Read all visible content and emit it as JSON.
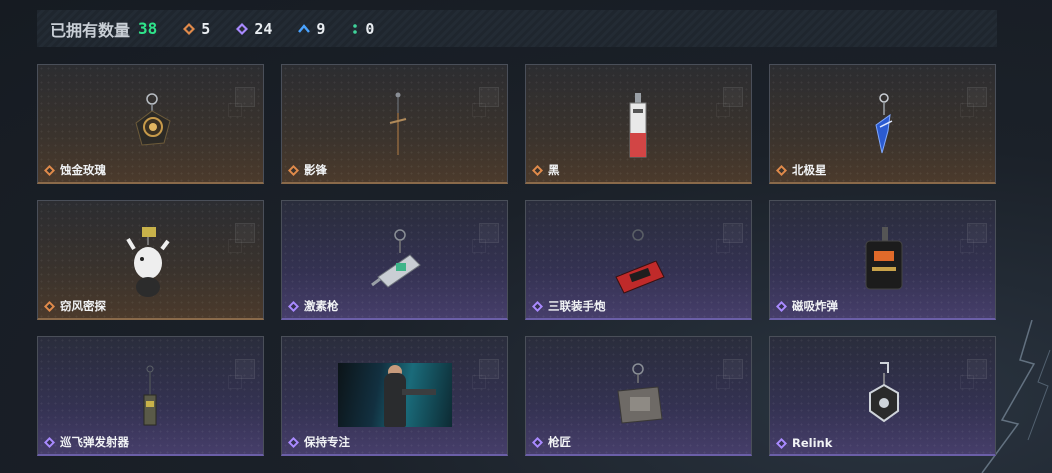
{
  "header": {
    "owned_label": "已拥有数量",
    "owned_count": "38",
    "stats": [
      {
        "icon": "orange-diamond-icon",
        "count": "5",
        "color": "#e08a4a"
      },
      {
        "icon": "purple-diamond-icon",
        "count": "24",
        "color": "#a98aff"
      },
      {
        "icon": "blue-chevron-icon",
        "count": "9",
        "color": "#4aa3ff"
      },
      {
        "icon": "green-dots-icon",
        "count": "0",
        "color": "#3fd39a"
      }
    ]
  },
  "items": [
    {
      "name": "蚀金玫瑰",
      "rarity": "orange"
    },
    {
      "name": "影锋",
      "rarity": "orange"
    },
    {
      "name": "黑",
      "rarity": "orange"
    },
    {
      "name": "北极星",
      "rarity": "orange"
    },
    {
      "name": "窃风密探",
      "rarity": "orange"
    },
    {
      "name": "激素枪",
      "rarity": "purple"
    },
    {
      "name": "三联装手炮",
      "rarity": "purple"
    },
    {
      "name": "磁吸炸弹",
      "rarity": "purple"
    },
    {
      "name": "巡飞弹发射器",
      "rarity": "purple"
    },
    {
      "name": "保持专注",
      "rarity": "purple"
    },
    {
      "name": "枪匠",
      "rarity": "purple"
    },
    {
      "name": "Relink",
      "rarity": "purple"
    }
  ],
  "colors": {
    "accent_green": "#2fe38a",
    "orange_rarity": "#e08a4a",
    "purple_rarity": "#a98aff"
  }
}
